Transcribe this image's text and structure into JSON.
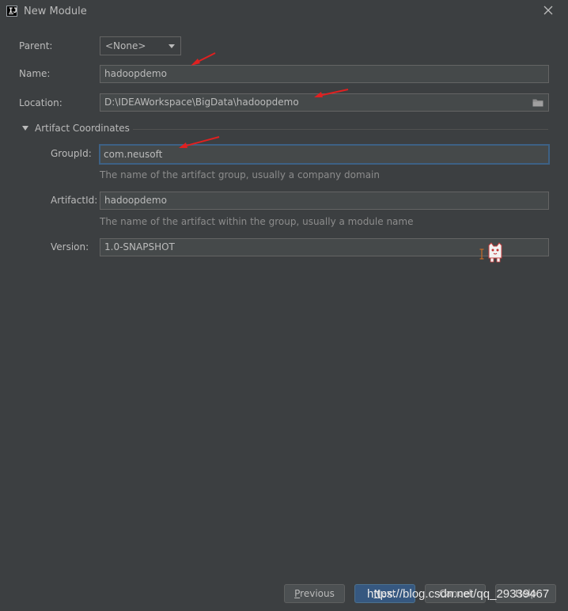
{
  "window": {
    "title": "New Module"
  },
  "form": {
    "parent": {
      "label": "Parent:",
      "value": "<None>"
    },
    "name": {
      "label": "Name:",
      "value": "hadoopdemo"
    },
    "location": {
      "label": "Location:",
      "value": "D:\\IDEAWorkspace\\BigData\\hadoopdemo"
    }
  },
  "artifact": {
    "section_title": "Artifact Coordinates",
    "group_id": {
      "label": "GroupId:",
      "value": "com.neusoft",
      "hint": "The name of the artifact group, usually a company domain"
    },
    "artifact_id": {
      "label": "ArtifactId:",
      "value": "hadoopdemo",
      "hint": "The name of the artifact within the group, usually a module name"
    },
    "version": {
      "label": "Version:",
      "value": "1.0-SNAPSHOT"
    }
  },
  "buttons": {
    "previous_prefix": "",
    "previous_mnemonic": "P",
    "previous_rest": "revious",
    "next_mnemonic": "N",
    "next_rest": "ext",
    "cancel": "Cancel",
    "help": "Help"
  },
  "watermark": "https://blog.csdn.net/qq_29339467",
  "icons": {
    "app": "intellij-idea-icon",
    "close": "close-icon",
    "folder": "folder-icon"
  },
  "colors": {
    "background": "#3c3f41",
    "field": "#45494a",
    "focus": "#3d6185",
    "default_button": "#365880",
    "annotation_arrow": "#e02020"
  }
}
